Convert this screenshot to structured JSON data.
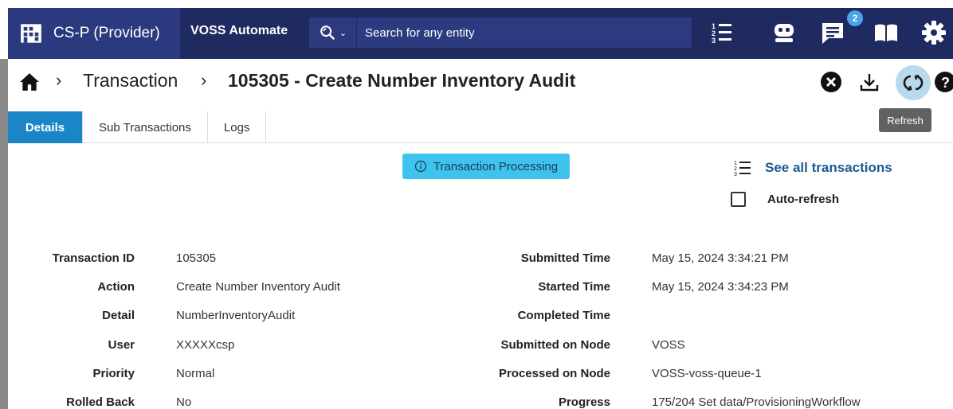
{
  "header": {
    "tenant_name": "CS-P (Provider)",
    "app_name": "VOSS Automate",
    "search_placeholder": "Search for any entity",
    "notifications_count": "2",
    "icons": [
      "building-icon",
      "search-scope-icon",
      "list-icon",
      "bot-icon",
      "chat-icon",
      "book-icon",
      "gear-icon"
    ]
  },
  "breadcrumb": {
    "items": [
      "Transaction"
    ],
    "current": "105305 - Create Number Inventory Audit"
  },
  "toolbar": {
    "refresh_tooltip": "Refresh"
  },
  "tabs": [
    {
      "label": "Details",
      "active": true
    },
    {
      "label": "Sub Transactions",
      "active": false
    },
    {
      "label": "Logs",
      "active": false
    }
  ],
  "status": {
    "label": "Transaction Processing",
    "color": "#3ec3ee"
  },
  "links": {
    "see_all": "See all transactions",
    "auto_refresh": "Auto-refresh",
    "auto_refresh_checked": false
  },
  "details_left": [
    {
      "label": "Transaction ID",
      "value": "105305"
    },
    {
      "label": "Action",
      "value": "Create Number Inventory Audit"
    },
    {
      "label": "Detail",
      "value": "NumberInventoryAudit"
    },
    {
      "label": "User",
      "value": "XXXXXcsp"
    },
    {
      "label": "Priority",
      "value": "Normal"
    },
    {
      "label": "Rolled Back",
      "value": "No"
    }
  ],
  "details_right": [
    {
      "label": "Submitted Time",
      "value": "May 15, 2024 3:34:21 PM"
    },
    {
      "label": "Started Time",
      "value": "May 15, 2024 3:34:23 PM"
    },
    {
      "label": "Completed Time",
      "value": ""
    },
    {
      "label": "Submitted on Node",
      "value": "VOSS"
    },
    {
      "label": "Processed on Node",
      "value": "VOSS-voss-queue-1"
    },
    {
      "label": "Progress",
      "value": "175/204 Set data/ProvisioningWorkflow"
    }
  ]
}
